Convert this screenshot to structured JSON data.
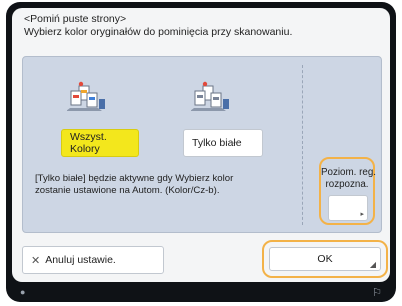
{
  "header": {
    "title": "<Pomiń puste strony>",
    "subtitle": "Wybierz kolor oryginałów do pominięcia przy skanowaniu."
  },
  "options": {
    "all_colors_label": "Wszyst. Kolory",
    "all_colors_selected": true,
    "bw_only_label": "Tylko białe",
    "bw_only_selected": false
  },
  "note": {
    "line1": "[Tylko białe] będzie aktywne gdy Wybierz kolor",
    "line2": "zostanie ustawione na Autom. (Kolor/Cz-b)."
  },
  "level_button": {
    "line1": "Poziom. reg.",
    "line2": "rozpozna."
  },
  "footer": {
    "cancel_label": "Anuluj ustawie.",
    "ok_label": "OK"
  },
  "colors": {
    "highlight_border": "#f3b248",
    "selected_fill": "#f3e71c",
    "panel_fill": "#cdd6e4"
  }
}
